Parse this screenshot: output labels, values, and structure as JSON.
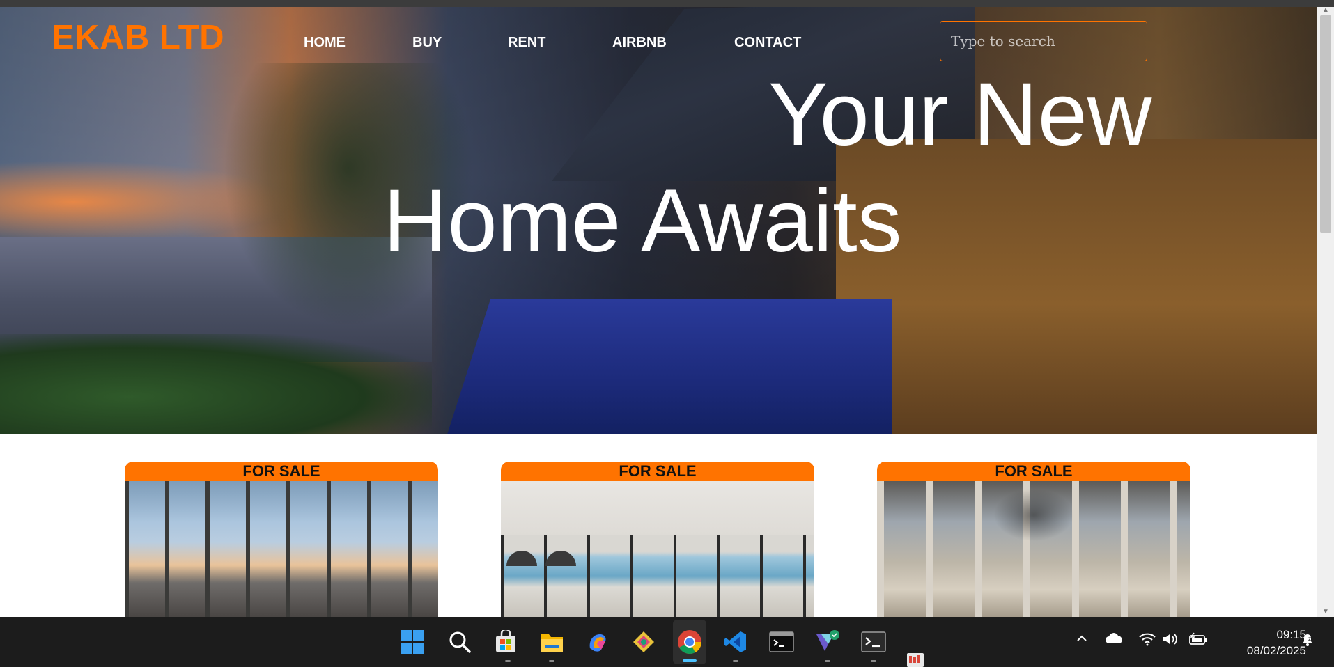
{
  "site": {
    "logo": "EKAB LTD",
    "nav": [
      "HOME",
      "BUY",
      "RENT",
      "AIRBNB",
      "CONTACT"
    ],
    "search_placeholder": "Type to search",
    "headline_line1": "Your New",
    "headline_line2": "Home Awaits",
    "accent_color": "#ff7300"
  },
  "listings": [
    {
      "badge": "FOR SALE",
      "image": "penthouse-living-room-city-view"
    },
    {
      "badge": "FOR SALE",
      "image": "modern-living-room-ocean-view"
    },
    {
      "badge": "FOR SALE",
      "image": "living-room-chandelier-skyline"
    }
  ],
  "taskbar": {
    "apps": [
      "start-icon",
      "search-icon",
      "microsoft-store-icon",
      "file-explorer-icon",
      "copilot-icon",
      "snipping-tool-icon",
      "chrome-icon",
      "vscode-icon",
      "terminal-icon",
      "vpn-icon",
      "command-prompt-icon"
    ],
    "tray_icons": [
      "chevron-up-icon",
      "onedrive-icon",
      "wifi-icon",
      "volume-icon",
      "battery-icon",
      "notification-icon"
    ],
    "time": "09:15",
    "date": "08/02/2025"
  }
}
